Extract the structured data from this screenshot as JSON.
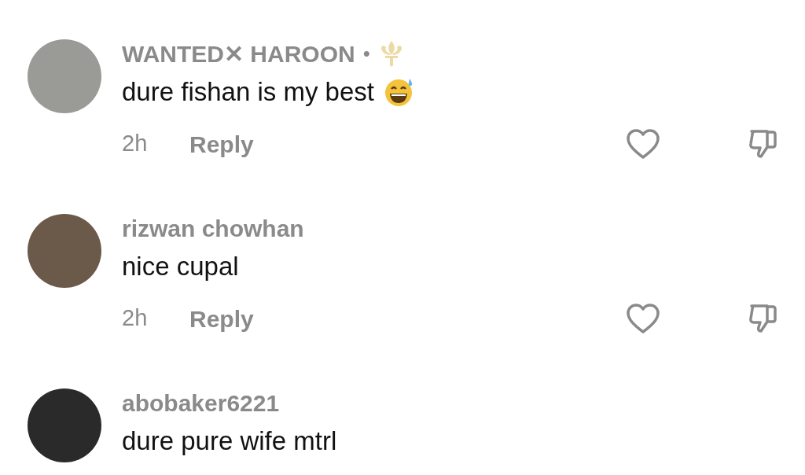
{
  "comments": [
    {
      "username": "WANTED✕ HAROON",
      "separator": "•",
      "has_badge": true,
      "text": "dure fishan is my best",
      "has_emoji": true,
      "time": "2h",
      "reply": "Reply"
    },
    {
      "username": "rizwan chowhan",
      "has_badge": false,
      "text": "nice cupal",
      "has_emoji": false,
      "time": "2h",
      "reply": "Reply"
    },
    {
      "username": "abobaker6221",
      "has_badge": false,
      "text": "dure pure wife mtrl",
      "has_emoji": false
    }
  ]
}
